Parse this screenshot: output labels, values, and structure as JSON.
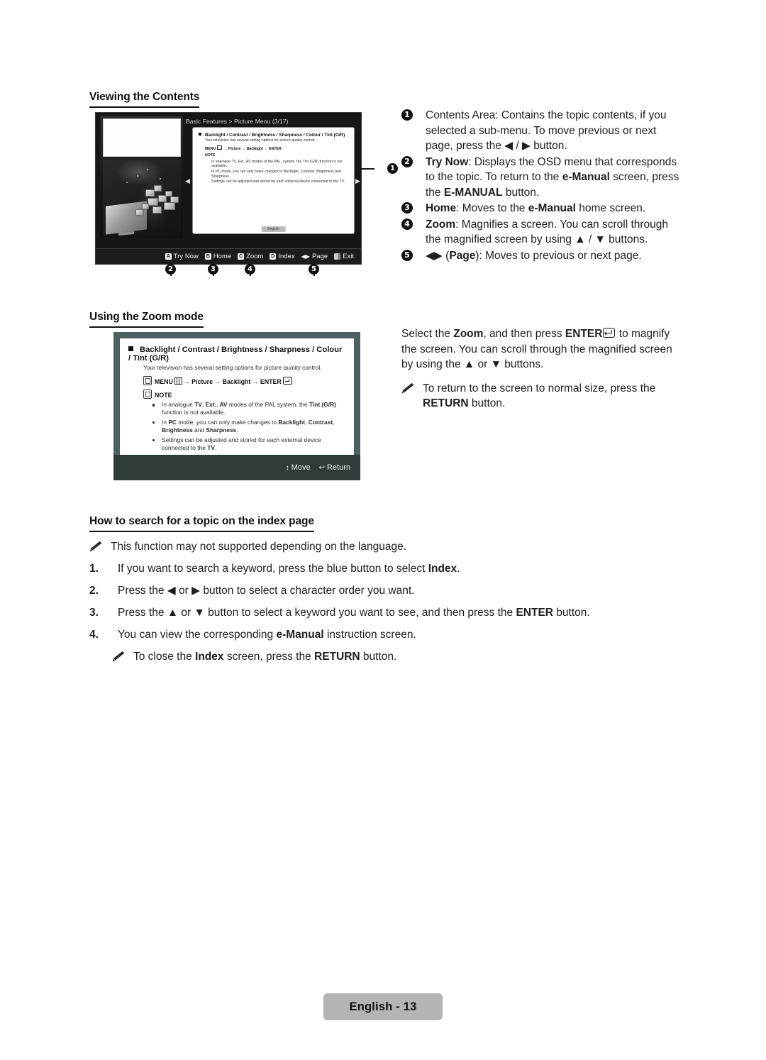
{
  "page": {
    "footer_label": "English - 13"
  },
  "sections": {
    "viewing_contents": {
      "heading": "Viewing the Contents",
      "callouts": [
        {
          "num": "1",
          "lead_bold": "",
          "text": "Contents Area: Contains the topic contents, if you selected a sub-menu. To move previous or next page, press the ◀ / ▶ button."
        },
        {
          "num": "2",
          "lead_bold": "Try Now",
          "text": ": Displays the OSD menu that corresponds to the topic. To return to the e-Manual screen, press the E-MANUAL button."
        },
        {
          "num": "3",
          "lead_bold": "Home",
          "text": ": Moves to the e-Manual home screen."
        },
        {
          "num": "4",
          "lead_bold": "Zoom",
          "text": ": Magnifies a screen. You can scroll through the magnified screen by using ▲ / ▼ buttons."
        },
        {
          "num": "5",
          "lead_bold": "",
          "text": "◀▶ (Page): Moves to previous or next page."
        }
      ],
      "figure_markers": [
        "1",
        "2",
        "3",
        "4",
        "5"
      ]
    },
    "zoom_mode": {
      "heading": "Using the Zoom mode",
      "body_1": "Select the Zoom, and then press ENTER",
      "body_1_tail": " to magnify the screen. You can scroll through the magnified screen by using the ▲ or ▼ buttons.",
      "note": "To return to the screen to normal size, press the RETURN  button."
    },
    "index_search": {
      "heading": "How to search for a topic on the index page",
      "intro_note": "This function may not supported depending on the language.",
      "steps": [
        {
          "num": "1.",
          "text": "If you want to search a keyword, press the blue button to select Index."
        },
        {
          "num": "2.",
          "text": "Press the ◀ or ▶ button to select a character order you want."
        },
        {
          "num": "3.",
          "text": "Press the ▲ or ▼ button to select a keyword you want to see, and then press the ENTER button."
        },
        {
          "num": "4.",
          "text": "You can view the corresponding e-Manual instruction screen."
        }
      ],
      "closing_note": "To close the Index screen, press the RETURN button."
    }
  },
  "figure1": {
    "title": "Basic Features > Picture Menu (3/17)",
    "topic_heading": "Backlight / Contrast / Brightness / Sharpness / Colour / Tint (G/R)",
    "topic_sub": "Your television has several setting options for picture quality control.",
    "menu_path_pre": "MENU",
    "menu_path_post": "→ Picture → Backlight → ENTER",
    "note_label": "NOTE",
    "notes": [
      "In analogue TV, Ext., AV modes of the PAL, system, the Tint (G/R) function is not available.",
      "In PC mode, you can only make changes to Backlight, Contrast, Brightness and Sharpness.",
      "Settings can be adjusted and stored for each external device connected to the TV."
    ],
    "language_tab": "English",
    "keys": [
      {
        "key": "A",
        "label": "Try Now"
      },
      {
        "key": "B",
        "label": "Home"
      },
      {
        "key": "C",
        "label": "Zoom"
      },
      {
        "key": "D",
        "label": "Index"
      },
      {
        "key": "◀▶",
        "label": "Page"
      },
      {
        "key": "exit",
        "label": "Exit"
      }
    ]
  },
  "figure2": {
    "topic_heading": "Backlight / Contrast / Brightness / Sharpness / Colour / Tint (G/R)",
    "topic_sub": "Your television has several setting options for picture quality control.",
    "menu_path_pre": "MENU",
    "menu_path_mid": "→ Picture → Backlight → ENTER",
    "note_label": "NOTE",
    "notes": [
      "In analogue TV, Ext., AV modes of the PAL system, the Tint (G/R) function is not available.",
      "In PC mode, you can only make changes to Backlight, Contrast, Brightness and Sharpness.",
      "Settings can be adjusted and stored for each external device connected to the TV."
    ],
    "bar": [
      {
        "icon": "↕",
        "label": "Move"
      },
      {
        "icon": "↩",
        "label": "Return"
      }
    ]
  },
  "colors": {
    "panel_border": "#4b6060",
    "panel_bar": "#2f3b3b",
    "screen_bg": "#161616",
    "footer_bg": "#b4b4b4"
  }
}
